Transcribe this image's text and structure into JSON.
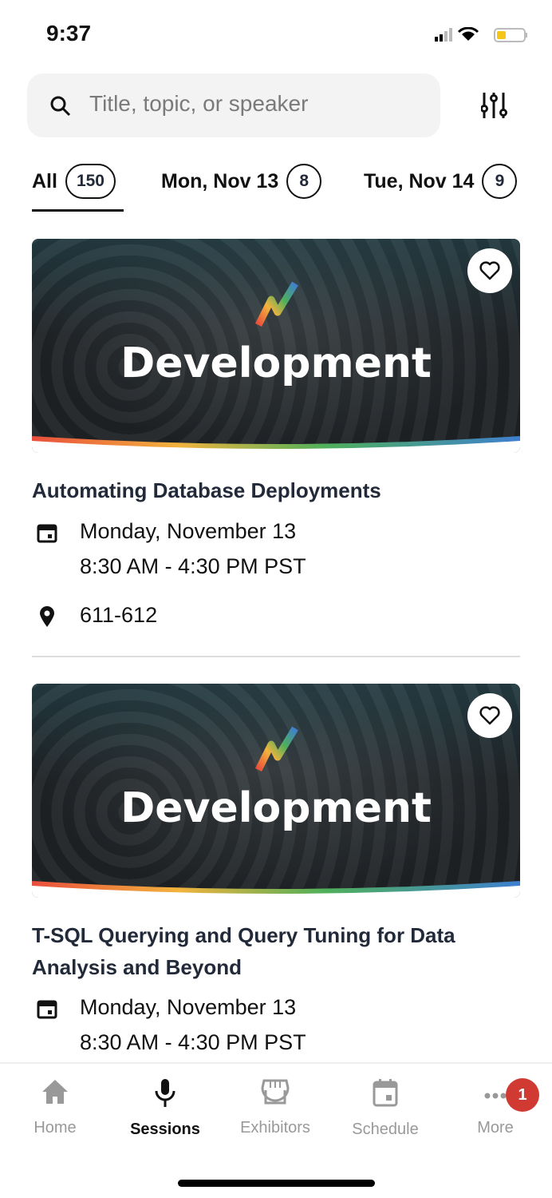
{
  "status": {
    "time": "9:37"
  },
  "search": {
    "placeholder": "Title, topic, or speaker"
  },
  "tabs": [
    {
      "label": "All",
      "count": "150"
    },
    {
      "label": "Mon, Nov 13",
      "count": "8"
    },
    {
      "label": "Tue, Nov 14",
      "count": "9"
    }
  ],
  "sessions": [
    {
      "banner": "Development",
      "title": "Automating Database Deployments",
      "date": "Monday, November 13",
      "time": "8:30 AM - 4:30 PM PST",
      "location": "611-612"
    },
    {
      "banner": "Development",
      "title": "T-SQL Querying and Query Tuning for Data Analysis and Beyond",
      "date": "Monday, November 13",
      "time": "8:30 AM - 4:30 PM PST"
    }
  ],
  "nav": [
    {
      "label": "Home"
    },
    {
      "label": "Sessions"
    },
    {
      "label": "Exhibitors"
    },
    {
      "label": "Schedule"
    },
    {
      "label": "More",
      "badge": "1"
    }
  ],
  "colors": {
    "badge": "#d03a32",
    "title": "#222a3a"
  }
}
